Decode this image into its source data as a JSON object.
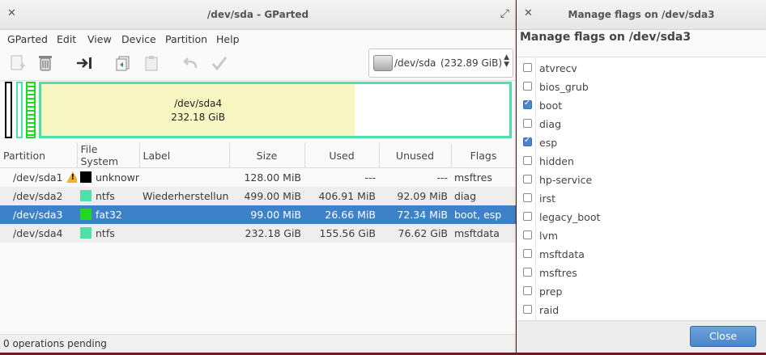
{
  "main": {
    "title": "/dev/sda - GParted",
    "menu": [
      "GParted",
      "Edit",
      "View",
      "Device",
      "Partition",
      "Help"
    ],
    "toolbar_icons": [
      "new-icon",
      "delete-icon",
      "resize-move-icon",
      "copy-icon",
      "paste-icon",
      "undo-icon",
      "apply-icon"
    ],
    "device": {
      "name": "/dev/sda",
      "size": "(232.89 GiB)"
    },
    "diskmap": {
      "label": "/dev/sda4",
      "size": "232.18 GiB",
      "used_fraction": 0.67
    },
    "columns": [
      "Partition",
      "File System",
      "Label",
      "Size",
      "Used",
      "Unused",
      "Flags"
    ],
    "rows": [
      {
        "partition": "/dev/sda1",
        "warning": true,
        "fs": "unknown",
        "fs_color": "#000000",
        "label": "",
        "size": "128.00 MiB",
        "used": "---",
        "unused": "---",
        "flags": "msftres"
      },
      {
        "partition": "/dev/sda2",
        "warning": false,
        "fs": "ntfs",
        "fs_color": "#4ee0a6",
        "label": "Wiederherstellung",
        "size": "499.00 MiB",
        "used": "406.91 MiB",
        "unused": "92.09 MiB",
        "flags": "diag"
      },
      {
        "partition": "/dev/sda3",
        "warning": false,
        "fs": "fat32",
        "fs_color": "#22d822",
        "label": "",
        "size": "99.00 MiB",
        "used": "26.66 MiB",
        "unused": "72.34 MiB",
        "flags": "boot, esp"
      },
      {
        "partition": "/dev/sda4",
        "warning": false,
        "fs": "ntfs",
        "fs_color": "#4ee0a6",
        "label": "",
        "size": "232.18 GiB",
        "used": "155.56 GiB",
        "unused": "76.62 GiB",
        "flags": "msftdata"
      }
    ],
    "status": "0 operations pending"
  },
  "dialog": {
    "title": "Manage flags on /dev/sda3",
    "heading": "Manage flags on /dev/sda3",
    "flags": [
      {
        "name": "atvrecv",
        "checked": false
      },
      {
        "name": "bios_grub",
        "checked": false
      },
      {
        "name": "boot",
        "checked": true
      },
      {
        "name": "diag",
        "checked": false
      },
      {
        "name": "esp",
        "checked": true
      },
      {
        "name": "hidden",
        "checked": false
      },
      {
        "name": "hp-service",
        "checked": false
      },
      {
        "name": "irst",
        "checked": false
      },
      {
        "name": "legacy_boot",
        "checked": false
      },
      {
        "name": "lvm",
        "checked": false
      },
      {
        "name": "msftdata",
        "checked": false
      },
      {
        "name": "msftres",
        "checked": false
      },
      {
        "name": "prep",
        "checked": false
      },
      {
        "name": "raid",
        "checked": false
      }
    ],
    "close_label": "Close"
  }
}
